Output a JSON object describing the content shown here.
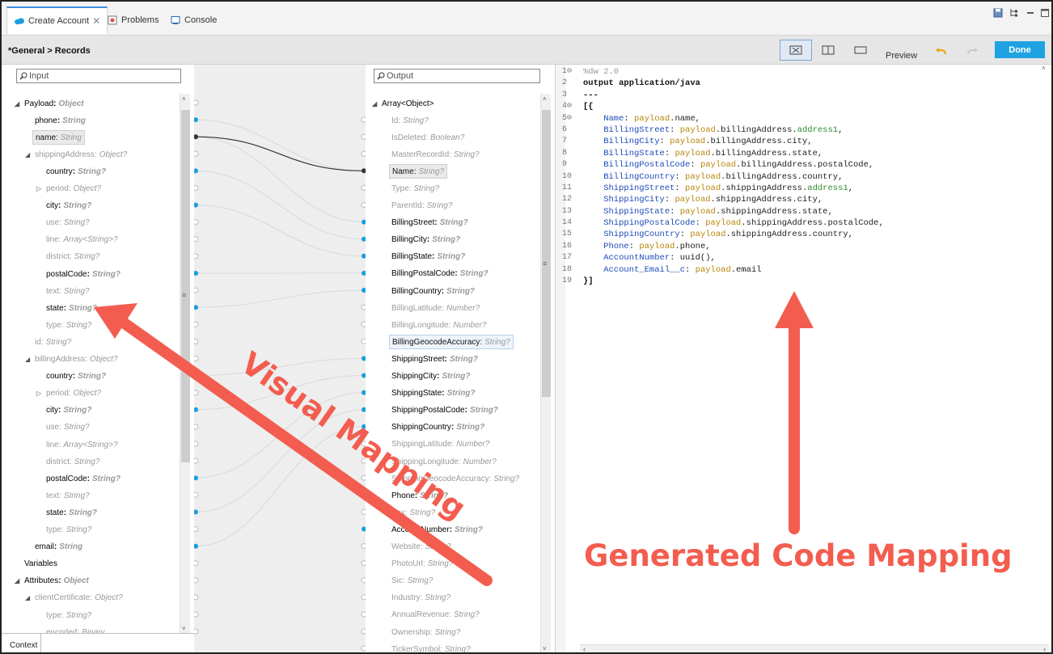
{
  "tabs": [
    {
      "label": "Create Account",
      "active": true
    },
    {
      "label": "Problems",
      "active": false
    },
    {
      "label": "Console",
      "active": false
    }
  ],
  "header": {
    "breadcrumb": "*General > Records",
    "preview_label": "Preview",
    "done_label": "Done"
  },
  "input": {
    "search_placeholder": "Input",
    "items": [
      {
        "name": "Payload",
        "type": "Object",
        "depth": 0,
        "expander": "open",
        "style": "bold"
      },
      {
        "name": "phone",
        "type": "String",
        "depth": 1,
        "style": "bold"
      },
      {
        "name": "name",
        "type": "String",
        "depth": 1,
        "style": "hl"
      },
      {
        "name": "shippingAddress",
        "type": "Object?",
        "depth": 1,
        "expander": "open",
        "style": "dim"
      },
      {
        "name": "country",
        "type": "String?",
        "depth": 2,
        "style": "bold"
      },
      {
        "name": "period",
        "type": "Object?",
        "depth": 2,
        "expander": "closed",
        "style": "dim"
      },
      {
        "name": "city",
        "type": "String?",
        "depth": 2,
        "style": "bold"
      },
      {
        "name": "use",
        "type": "String?",
        "depth": 2,
        "style": "dim"
      },
      {
        "name": "line",
        "type": "Array<String>?",
        "depth": 2,
        "style": "dim"
      },
      {
        "name": "district",
        "type": "String?",
        "depth": 2,
        "style": "dim"
      },
      {
        "name": "postalCode",
        "type": "String?",
        "depth": 2,
        "style": "bold"
      },
      {
        "name": "text",
        "type": "String?",
        "depth": 2,
        "style": "dim"
      },
      {
        "name": "state",
        "type": "String?",
        "depth": 2,
        "style": "bold"
      },
      {
        "name": "type",
        "type": "String?",
        "depth": 2,
        "style": "dim"
      },
      {
        "name": "id",
        "type": "String?",
        "depth": 1,
        "style": "dim"
      },
      {
        "name": "billingAddress",
        "type": "Object?",
        "depth": 1,
        "expander": "open",
        "style": "dim"
      },
      {
        "name": "country",
        "type": "String?",
        "depth": 2,
        "style": "bold"
      },
      {
        "name": "period",
        "type": "Object?",
        "depth": 2,
        "expander": "closed",
        "style": "dim"
      },
      {
        "name": "city",
        "type": "String?",
        "depth": 2,
        "style": "bold"
      },
      {
        "name": "use",
        "type": "String?",
        "depth": 2,
        "style": "dim"
      },
      {
        "name": "line",
        "type": "Array<String>?",
        "depth": 2,
        "style": "dim"
      },
      {
        "name": "district",
        "type": "String?",
        "depth": 2,
        "style": "dim"
      },
      {
        "name": "postalCode",
        "type": "String?",
        "depth": 2,
        "style": "bold"
      },
      {
        "name": "text",
        "type": "String?",
        "depth": 2,
        "style": "dim"
      },
      {
        "name": "state",
        "type": "String?",
        "depth": 2,
        "style": "bold"
      },
      {
        "name": "type",
        "type": "String?",
        "depth": 2,
        "style": "dim"
      },
      {
        "name": "email",
        "type": "String",
        "depth": 1,
        "style": "bold"
      },
      {
        "name": "Variables",
        "type": "",
        "depth": 0,
        "style": "bold"
      },
      {
        "name": "Attributes",
        "type": "Object",
        "depth": 0,
        "expander": "open",
        "style": "bold"
      },
      {
        "name": "clientCertificate",
        "type": "Object?",
        "depth": 1,
        "expander": "open",
        "style": "dim"
      },
      {
        "name": "type",
        "type": "String?",
        "depth": 2,
        "style": "dim"
      },
      {
        "name": "encoded",
        "type": "Binary",
        "depth": 2,
        "style": "dim"
      }
    ],
    "context_label": "Context"
  },
  "output": {
    "search_placeholder": "Output",
    "root": {
      "name": "Array<Object>"
    },
    "items": [
      {
        "name": "Id",
        "type": "String?",
        "style": "dim"
      },
      {
        "name": "IsDeleted",
        "type": "Boolean?",
        "style": "dim"
      },
      {
        "name": "MasterRecordId",
        "type": "String?",
        "style": "dim"
      },
      {
        "name": "Name",
        "type": "String?",
        "style": "hl"
      },
      {
        "name": "Type",
        "type": "String?",
        "style": "dim"
      },
      {
        "name": "ParentId",
        "type": "String?",
        "style": "dim"
      },
      {
        "name": "BillingStreet",
        "type": "String?",
        "style": "bold"
      },
      {
        "name": "BillingCity",
        "type": "String?",
        "style": "bold"
      },
      {
        "name": "BillingState",
        "type": "String?",
        "style": "bold"
      },
      {
        "name": "BillingPostalCode",
        "type": "String?",
        "style": "bold"
      },
      {
        "name": "BillingCountry",
        "type": "String?",
        "style": "bold"
      },
      {
        "name": "BillingLatitude",
        "type": "Number?",
        "style": "dim"
      },
      {
        "name": "BillingLongitude",
        "type": "Number?",
        "style": "dim"
      },
      {
        "name": "BillingGeocodeAccuracy",
        "type": "String?",
        "style": "hl2"
      },
      {
        "name": "ShippingStreet",
        "type": "String?",
        "style": "bold"
      },
      {
        "name": "ShippingCity",
        "type": "String?",
        "style": "bold"
      },
      {
        "name": "ShippingState",
        "type": "String?",
        "style": "bold"
      },
      {
        "name": "ShippingPostalCode",
        "type": "String?",
        "style": "bold"
      },
      {
        "name": "ShippingCountry",
        "type": "String?",
        "style": "bold"
      },
      {
        "name": "ShippingLatitude",
        "type": "Number?",
        "style": "dim"
      },
      {
        "name": "ShippingLongitude",
        "type": "Number?",
        "style": "dim"
      },
      {
        "name": "ShippingGeocodeAccuracy",
        "type": "String?",
        "style": "dim"
      },
      {
        "name": "Phone",
        "type": "String?",
        "style": "bold"
      },
      {
        "name": "Fax",
        "type": "String?",
        "style": "dim"
      },
      {
        "name": "AccountNumber",
        "type": "String?",
        "style": "bold"
      },
      {
        "name": "Website",
        "type": "String?",
        "style": "dim"
      },
      {
        "name": "PhotoUrl",
        "type": "String?",
        "style": "dim"
      },
      {
        "name": "Sic",
        "type": "String?",
        "style": "dim"
      },
      {
        "name": "Industry",
        "type": "String?",
        "style": "dim"
      },
      {
        "name": "AnnualRevenue",
        "type": "String?",
        "style": "dim"
      },
      {
        "name": "Ownership",
        "type": "String?",
        "style": "dim"
      },
      {
        "name": "TickerSymbol",
        "type": "String?",
        "style": "dim"
      }
    ]
  },
  "code": {
    "lines": [
      [
        {
          "t": "%dw 2.0",
          "c": "hdr"
        }
      ],
      [
        {
          "t": "output application/java",
          "c": "bold"
        }
      ],
      [
        {
          "t": "---",
          "c": "bold"
        }
      ],
      [
        {
          "t": "[{",
          "c": "bold"
        }
      ],
      [
        {
          "t": "    Name",
          "c": "k"
        },
        {
          "t": ": ",
          "c": ""
        },
        {
          "t": "payload",
          "c": "p"
        },
        {
          "t": ".name,",
          "c": ""
        }
      ],
      [
        {
          "t": "    BillingStreet",
          "c": "k"
        },
        {
          "t": ": ",
          "c": ""
        },
        {
          "t": "payload",
          "c": "p"
        },
        {
          "t": ".billingAddress.",
          "c": ""
        },
        {
          "t": "address1",
          "c": "g"
        },
        {
          "t": ",",
          "c": ""
        }
      ],
      [
        {
          "t": "    BillingCity",
          "c": "k"
        },
        {
          "t": ": ",
          "c": ""
        },
        {
          "t": "payload",
          "c": "p"
        },
        {
          "t": ".billingAddress.city,",
          "c": ""
        }
      ],
      [
        {
          "t": "    BillingState",
          "c": "k"
        },
        {
          "t": ": ",
          "c": ""
        },
        {
          "t": "payload",
          "c": "p"
        },
        {
          "t": ".billingAddress.state,",
          "c": ""
        }
      ],
      [
        {
          "t": "    BillingPostalCode",
          "c": "k"
        },
        {
          "t": ": ",
          "c": ""
        },
        {
          "t": "payload",
          "c": "p"
        },
        {
          "t": ".billingAddress.postalCode,",
          "c": ""
        }
      ],
      [
        {
          "t": "    BillingCountry",
          "c": "k"
        },
        {
          "t": ": ",
          "c": ""
        },
        {
          "t": "payload",
          "c": "p"
        },
        {
          "t": ".billingAddress.country,",
          "c": ""
        }
      ],
      [
        {
          "t": "    ShippingStreet",
          "c": "k"
        },
        {
          "t": ": ",
          "c": ""
        },
        {
          "t": "payload",
          "c": "p"
        },
        {
          "t": ".shippingAddress.",
          "c": ""
        },
        {
          "t": "address1",
          "c": "g"
        },
        {
          "t": ",",
          "c": ""
        }
      ],
      [
        {
          "t": "    ShippingCity",
          "c": "k"
        },
        {
          "t": ": ",
          "c": ""
        },
        {
          "t": "payload",
          "c": "p"
        },
        {
          "t": ".shippingAddress.city,",
          "c": ""
        }
      ],
      [
        {
          "t": "    ShippingState",
          "c": "k"
        },
        {
          "t": ": ",
          "c": ""
        },
        {
          "t": "payload",
          "c": "p"
        },
        {
          "t": ".shippingAddress.state,",
          "c": ""
        }
      ],
      [
        {
          "t": "    ShippingPostalCode",
          "c": "k"
        },
        {
          "t": ": ",
          "c": ""
        },
        {
          "t": "payload",
          "c": "p"
        },
        {
          "t": ".shippingAddress.postalCode,",
          "c": ""
        }
      ],
      [
        {
          "t": "    ShippingCountry",
          "c": "k"
        },
        {
          "t": ": ",
          "c": ""
        },
        {
          "t": "payload",
          "c": "p"
        },
        {
          "t": ".shippingAddress.country,",
          "c": ""
        }
      ],
      [
        {
          "t": "    Phone",
          "c": "k"
        },
        {
          "t": ": ",
          "c": ""
        },
        {
          "t": "payload",
          "c": "p"
        },
        {
          "t": ".phone,",
          "c": ""
        }
      ],
      [
        {
          "t": "    AccountNumber",
          "c": "k"
        },
        {
          "t": ": uuid(),",
          "c": ""
        }
      ],
      [
        {
          "t": "    Account_Email__c",
          "c": "k"
        },
        {
          "t": ": ",
          "c": ""
        },
        {
          "t": "payload",
          "c": "p"
        },
        {
          "t": ".email",
          "c": ""
        }
      ],
      [
        {
          "t": "}]",
          "c": "bold"
        }
      ]
    ]
  },
  "annotations": {
    "visual": "Visual Mapping",
    "generated": "Generated Code Mapping"
  },
  "colors": {
    "accent": "#1fa2e1",
    "annotation": "#f35d4f",
    "mapping_dot": "#1b9ede"
  }
}
